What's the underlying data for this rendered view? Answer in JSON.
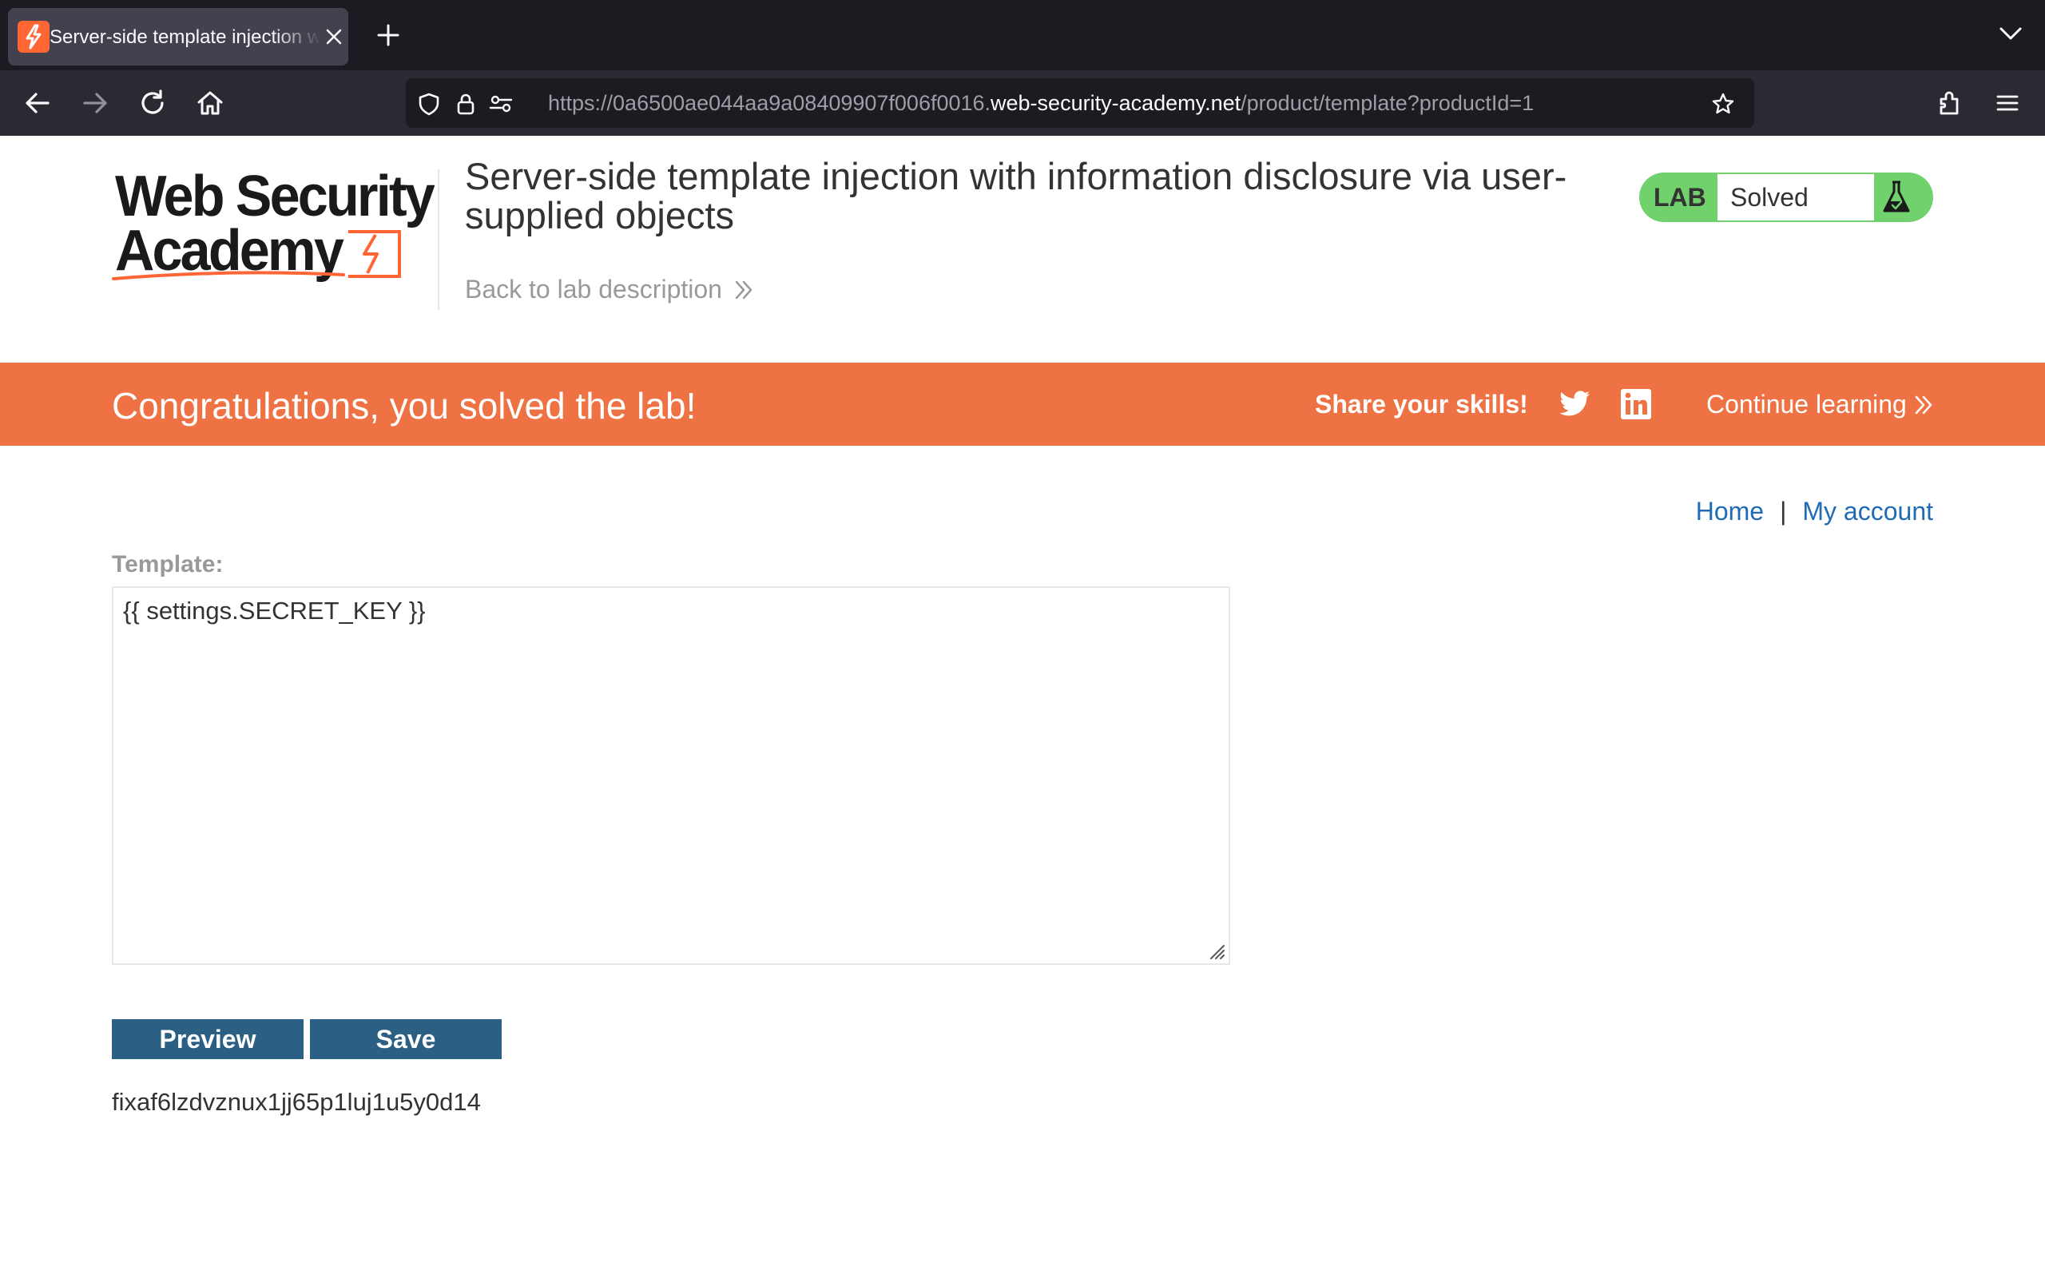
{
  "browser": {
    "tab": {
      "title": "Server-side template injection with information disclosure via user-supplied objects",
      "favicon": "portswigger-favicon"
    },
    "url": {
      "scheme_and_sub": "https://0a6500ae044aa9a08409907f006f0016.",
      "host": "web-security-academy.net",
      "path": "/product/template?productId=1"
    },
    "icons": [
      "back-arrow-icon",
      "forward-arrow-icon",
      "reload-icon",
      "home-icon",
      "shield-icon",
      "lock-icon",
      "permissions-icon",
      "star-icon",
      "extensions-icon",
      "menu-icon"
    ]
  },
  "header": {
    "logo_line1": "Web Security",
    "logo_line2": "Academy",
    "lab_title": "Server-side template injection with information disclosure via user-supplied objects",
    "back_link": "Back to lab description",
    "lab_badge": "LAB",
    "lab_status": "Solved"
  },
  "banner": {
    "message": "Congratulations, you solved the lab!",
    "share": "Share your skills!",
    "continue": "Continue learning"
  },
  "nav": {
    "home": "Home",
    "separator": "|",
    "account": "My account"
  },
  "form": {
    "label": "Template:",
    "template_value": "{{ settings.SECRET_KEY }}",
    "preview_button": "Preview",
    "save_button": "Save"
  },
  "output": {
    "result": "fixaf6lzdvznux1jj65p1luj1u5y0d14"
  },
  "colors": {
    "banner": "#ee7243",
    "button": "#2c5f84",
    "link": "#1f6bb5",
    "lab_status": "#70d16d",
    "brand_orange": "#ff6633"
  }
}
